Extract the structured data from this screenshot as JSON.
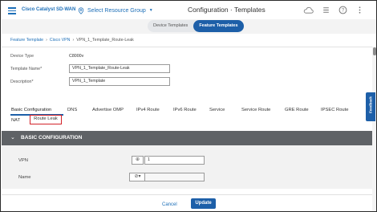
{
  "header": {
    "brand": "Cisco Catalyst SD-WAN",
    "resource_group": "Select Resource Group",
    "page_title": "Configuration · Templates"
  },
  "tabs": {
    "device_templates": "Device Templates",
    "feature_templates": "Feature Templates"
  },
  "breadcrumb": {
    "item1": "Feature Template",
    "item2": "Cisco VPN",
    "current": "VPN_1_Template_Route-Leak"
  },
  "form": {
    "device_type_label": "Device Type",
    "device_type_value": "C8000v",
    "template_name_label": "Template Name*",
    "template_name_value": "VPN_1_Template_Route-Leak",
    "description_label": "Description*",
    "description_value": "VPN_1_Template"
  },
  "feature_tabs": {
    "basic": "Basic Configuration",
    "dns": "DNS",
    "advertise_omp": "Advertise OMP",
    "ipv4_route": "IPv4 Route",
    "ipv6_route": "IPv6 Route",
    "service": "Service",
    "service_route": "Service Route",
    "gre_route": "GRE Route",
    "ipsec_route": "IPSEC Route",
    "nat": "NAT",
    "route_leak": "Route Leak"
  },
  "section": {
    "title": "BASIC CONFIGURATION",
    "vpn_label": "VPN",
    "vpn_value": "1",
    "name_label": "Name",
    "name_value": ""
  },
  "footer": {
    "cancel": "Cancel",
    "update": "Update"
  },
  "feedback": "Feedback",
  "colors": {
    "accent": "#1d5fa8",
    "link": "#1d6fb8",
    "highlight": "#d3232a",
    "section_bar": "#5f6266"
  }
}
